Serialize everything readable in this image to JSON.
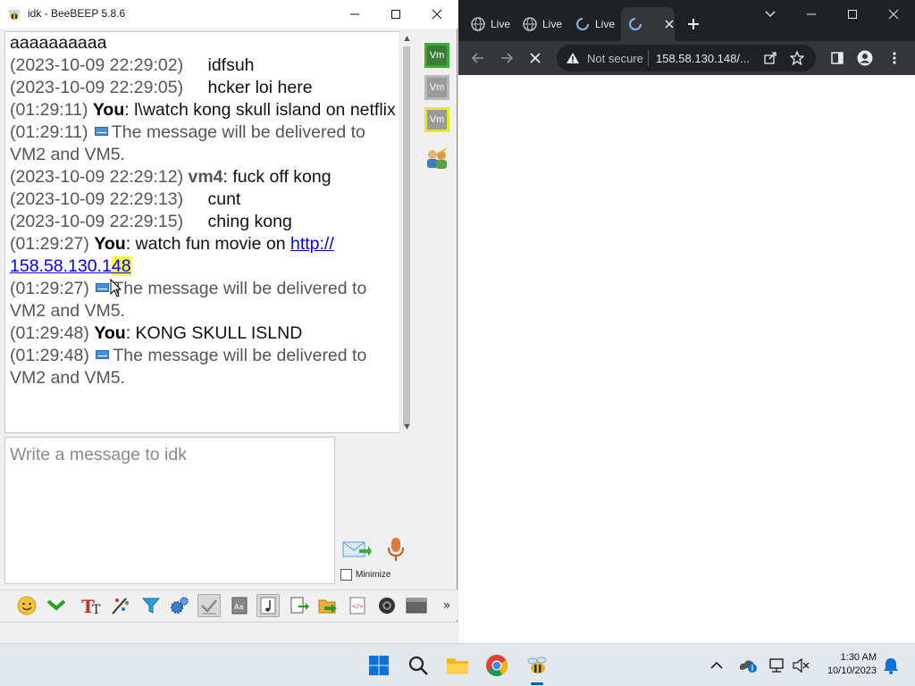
{
  "beebeep": {
    "title": "idk - BeeBEEP 5.8.6",
    "messages": [
      {
        "kind": "cont",
        "text": "aaaaaaaaaa"
      },
      {
        "kind": "remote",
        "time": "(2023-10-09 22:29:02)",
        "text": "idfsuh"
      },
      {
        "kind": "remote",
        "time": "(2023-10-09 22:29:05)",
        "text": "hcker loi here"
      },
      {
        "kind": "you",
        "time": "(01:29:11)",
        "sender": "You",
        "text": ": l\\watch kong skull island on netflix"
      },
      {
        "kind": "sys",
        "time": "(01:29:11)",
        "text": "The message will be delivered to VM2 and VM5."
      },
      {
        "kind": "vm4",
        "time": "(2023-10-09 22:29:12)",
        "sender": "vm4",
        "text": ": fuck off kong"
      },
      {
        "kind": "remote",
        "time": "(2023-10-09 22:29:13)",
        "text": "cunt"
      },
      {
        "kind": "remote",
        "time": "(2023-10-09 22:29:15)",
        "text": "ching kong"
      },
      {
        "kind": "youlink",
        "time": "(01:29:27)",
        "sender": "You",
        "text": ": watch fun movie on ",
        "link_a": "http://",
        "link_b": "158.58.130.1",
        "link_hl": "48"
      },
      {
        "kind": "sys",
        "time": "(01:29:27)",
        "text": "The message will be delivered to VM2 and VM5."
      },
      {
        "kind": "you",
        "time": "(01:29:48)",
        "sender": "You",
        "text": ": KONG SKULL ISLND"
      },
      {
        "kind": "sys",
        "time": "(01:29:48)",
        "text": "The message will be delivered to VM2 and VM5."
      }
    ],
    "users": [
      {
        "label": "Vm",
        "status": "on"
      },
      {
        "label": "Vm",
        "status": "off"
      },
      {
        "label": "Vm",
        "status": "away"
      }
    ],
    "compose_placeholder": "Write a message to idk",
    "minimize_label": "Minimize",
    "toolbar_more": "»"
  },
  "chrome": {
    "tabs": [
      {
        "label": "Live",
        "icon": "globe-icon"
      },
      {
        "label": "Live",
        "icon": "globe-icon"
      },
      {
        "label": "Live",
        "icon": "chrome-icon"
      },
      {
        "label": "",
        "icon": "chrome-icon",
        "active": true
      }
    ],
    "security_label": "Not secure",
    "url": "158.58.130.148/..."
  },
  "taskbar": {
    "time": "1:30 AM",
    "date": "10/10/2023"
  },
  "colors": {
    "link": "#0000ee",
    "highlight": "#ffff33",
    "chrome_dark": "#202124",
    "chrome_toolbar": "#35363a",
    "vm_online": "#2fb52f",
    "vm_away": "#e8e81a"
  }
}
